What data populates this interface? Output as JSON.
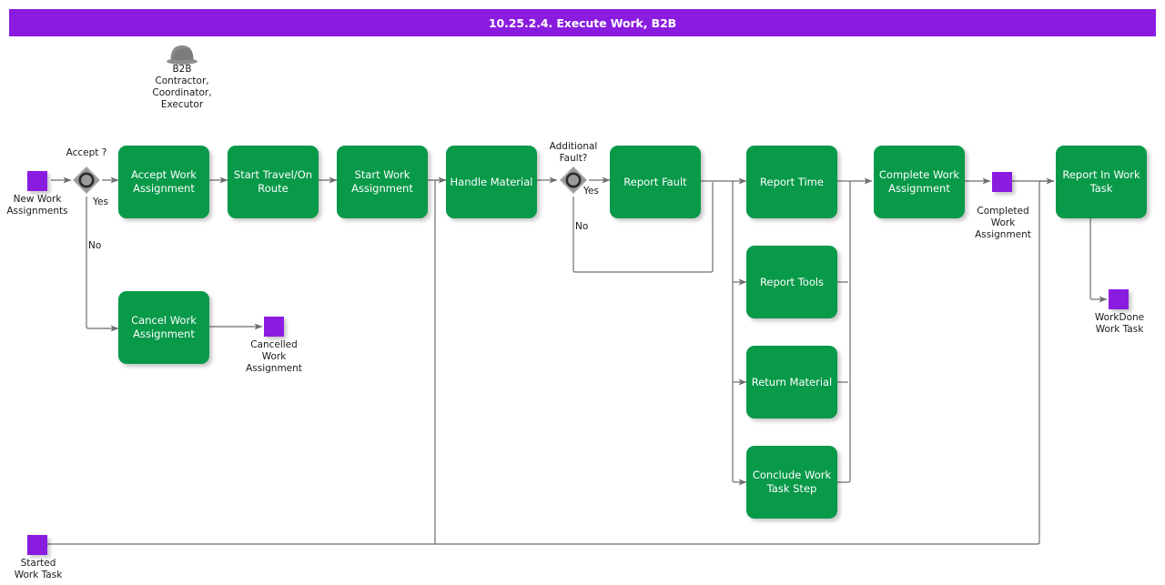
{
  "title_bar": {
    "title": "10.25.2.4. Execute Work, B2B",
    "bg": "#8A1CE0",
    "fg": "#FFFFFF"
  },
  "theme": {
    "task_fill": "#089949",
    "task_text": "#FFFFFF",
    "event_fill": "#8A1CE0",
    "gateway_fill": "#9A9A9A",
    "connector": "#6E6E6E",
    "label_text": "#1A1A1A"
  },
  "actor": {
    "icon": "bowler-hat-icon",
    "label": "B2B\nContractor,\nCoordinator,\nExecutor"
  },
  "events": [
    {
      "id": "new-work-assignments",
      "label": "New Work\nAssignments"
    },
    {
      "id": "cancelled-work-assignment",
      "label": "Cancelled\nWork\nAssignment"
    },
    {
      "id": "completed-work-assignment",
      "label": "Completed\nWork\nAssignment"
    },
    {
      "id": "workdone-work-task",
      "label": "WorkDone\nWork Task"
    },
    {
      "id": "started-work-task",
      "label": "Started\nWork Task"
    }
  ],
  "gateways": [
    {
      "id": "accept",
      "label": "Accept ?",
      "icon": "inclusive-gateway-icon"
    },
    {
      "id": "additional-fault",
      "label": "Additional\nFault?",
      "icon": "inclusive-gateway-icon"
    }
  ],
  "tasks": [
    {
      "id": "accept-work-assignment",
      "label": "Accept Work\nAssignment"
    },
    {
      "id": "start-travel-on-route",
      "label": "Start Travel/On\nRoute"
    },
    {
      "id": "start-work-assignment",
      "label": "Start Work\nAssignment"
    },
    {
      "id": "handle-material",
      "label": "Handle Material"
    },
    {
      "id": "report-fault",
      "label": "Report Fault"
    },
    {
      "id": "cancel-work-assignment",
      "label": "Cancel Work\nAssignment"
    },
    {
      "id": "report-time",
      "label": "Report Time"
    },
    {
      "id": "report-tools",
      "label": "Report Tools"
    },
    {
      "id": "return-material",
      "label": "Return Material"
    },
    {
      "id": "conclude-work-task-step",
      "label": "Conclude Work\nTask Step"
    },
    {
      "id": "complete-work-assignment",
      "label": "Complete Work\nAssignment"
    },
    {
      "id": "report-in-work-task",
      "label": "Report In Work\nTask"
    }
  ],
  "flow_labels": {
    "accept_yes": "Yes",
    "accept_no": "No",
    "fault_yes": "Yes",
    "fault_no": "No"
  }
}
